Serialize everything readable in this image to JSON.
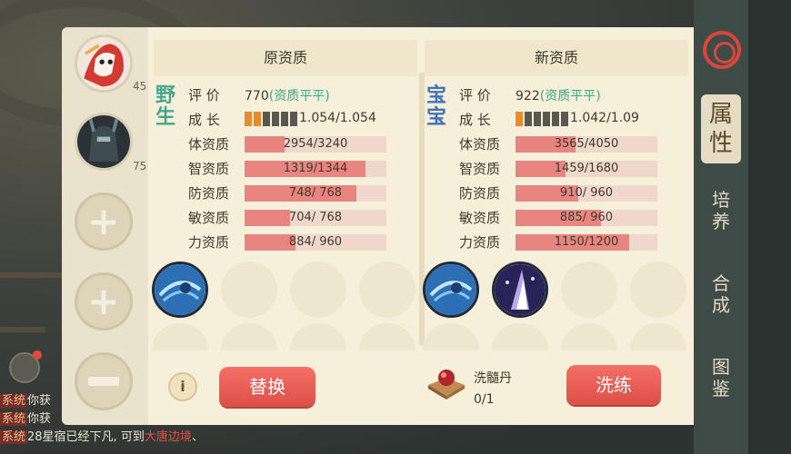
{
  "left_rail": {
    "slots": [
      {
        "type": "avatar",
        "level": "45"
      },
      {
        "type": "avatar",
        "level": "75"
      },
      {
        "type": "add"
      },
      {
        "type": "add"
      },
      {
        "type": "remove"
      }
    ]
  },
  "old": {
    "header": "原资质",
    "pet_type": "野生",
    "rating_label": "评 价",
    "rating_value": "770",
    "rating_tag": "(资质平平)",
    "growth_label": "成 长",
    "growth_level": 2,
    "growth_value": "1.054/1.054",
    "stats": [
      {
        "label": "体资质",
        "text": "2954/3240",
        "fraction": 0.28
      },
      {
        "label": "智资质",
        "text": "1319/1344",
        "fraction": 0.85
      },
      {
        "label": "防资质",
        "text": "748/ 768",
        "fraction": 0.79
      },
      {
        "label": "敏资质",
        "text": "704/ 768",
        "fraction": 0.32
      },
      {
        "label": "力资质",
        "text": "884/ 960",
        "fraction": 0.36
      }
    ]
  },
  "new": {
    "header": "新资质",
    "pet_type": "宝宝",
    "rating_label": "评 价",
    "rating_value": "922",
    "rating_tag": "(资质平平)",
    "growth_label": "成 长",
    "growth_level": 1,
    "growth_value": "1.042/1.09",
    "stats": [
      {
        "label": "体资质",
        "text": "3565/4050",
        "fraction": 0.42
      },
      {
        "label": "智资质",
        "text": "1459/1680",
        "fraction": 0.35
      },
      {
        "label": "防资质",
        "text": "910/ 960",
        "fraction": 0.44
      },
      {
        "label": "敏资质",
        "text": "885/ 960",
        "fraction": 0.6
      },
      {
        "label": "力资质",
        "text": "1150/1200",
        "fraction": 0.8
      }
    ]
  },
  "actions": {
    "replace_label": "替换",
    "item_name": "洗髓丹",
    "item_count": "0/1",
    "refine_label": "洗练",
    "info_glyph": "i"
  },
  "tabs": [
    {
      "label": "属\n性",
      "active": true
    },
    {
      "label": "培\n养",
      "active": false
    },
    {
      "label": "合\n成",
      "active": false
    },
    {
      "label": "图\n鉴",
      "active": false
    }
  ],
  "chat": [
    {
      "tag": "系统",
      "text": "你获"
    },
    {
      "tag": "系统",
      "text": "你获"
    },
    {
      "tag": "系统",
      "text": "28星宿已经下凡, 可到",
      "link": "大唐边境",
      "tail": "、"
    }
  ],
  "colors": {
    "panel_bg": "#f6efd9",
    "bar_fill": "#e98580",
    "bar_track": "#efd8cb",
    "wild_label": "#45a78a",
    "baby_label": "#3f74b7",
    "accent_red": "#dd4f47",
    "rating_tag": "#3aa882",
    "growth_on": "#e98a2c"
  },
  "icons": [
    "plus-icon",
    "minus-icon",
    "info-icon",
    "skill-water-icon",
    "skill-arcane-icon",
    "bead-chest-icon"
  ]
}
